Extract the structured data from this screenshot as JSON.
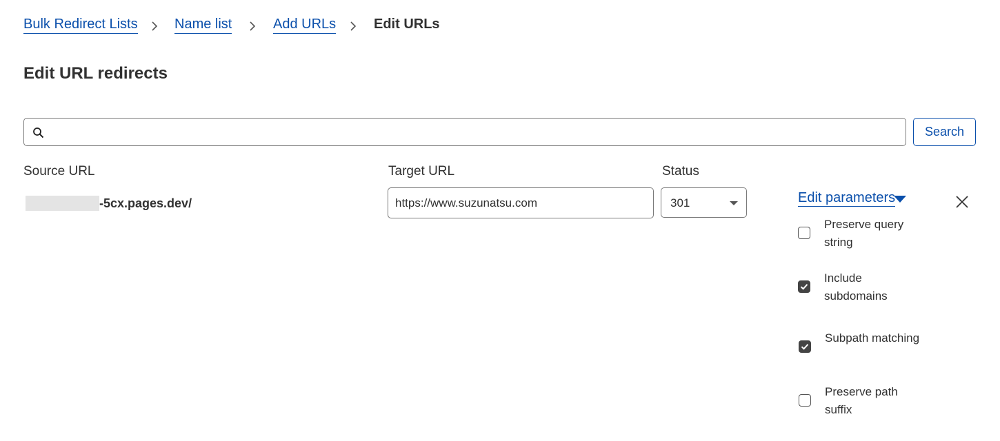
{
  "breadcrumb": {
    "items": [
      "Bulk Redirect Lists",
      "Name list",
      "Add URLs"
    ],
    "current": "Edit URLs"
  },
  "page": {
    "title": "Edit URL redirects"
  },
  "search": {
    "value": "",
    "placeholder": "",
    "button_label": "Search"
  },
  "table": {
    "headers": {
      "source": "Source URL",
      "target": "Target URL",
      "status": "Status"
    },
    "row": {
      "source_suffix": "-5cx.pages.dev/",
      "target_value": "https://www.suzunatsu.com",
      "status_value": "301"
    }
  },
  "params": {
    "toggle_label": "Edit parameters",
    "options": [
      {
        "label": "Preserve query string",
        "checked": false
      },
      {
        "label": "Include subdomains",
        "checked": true
      },
      {
        "label": "Subpath matching",
        "checked": true
      },
      {
        "label": "Preserve path suffix",
        "checked": false
      }
    ]
  },
  "colors": {
    "link": "#0a4fab",
    "text": "#313131",
    "checkbox_on": "#444444"
  },
  "icons": {
    "search": "search-icon",
    "close": "close-icon",
    "separator": "chevron-right-icon",
    "dropdown": "caret-down-icon"
  }
}
